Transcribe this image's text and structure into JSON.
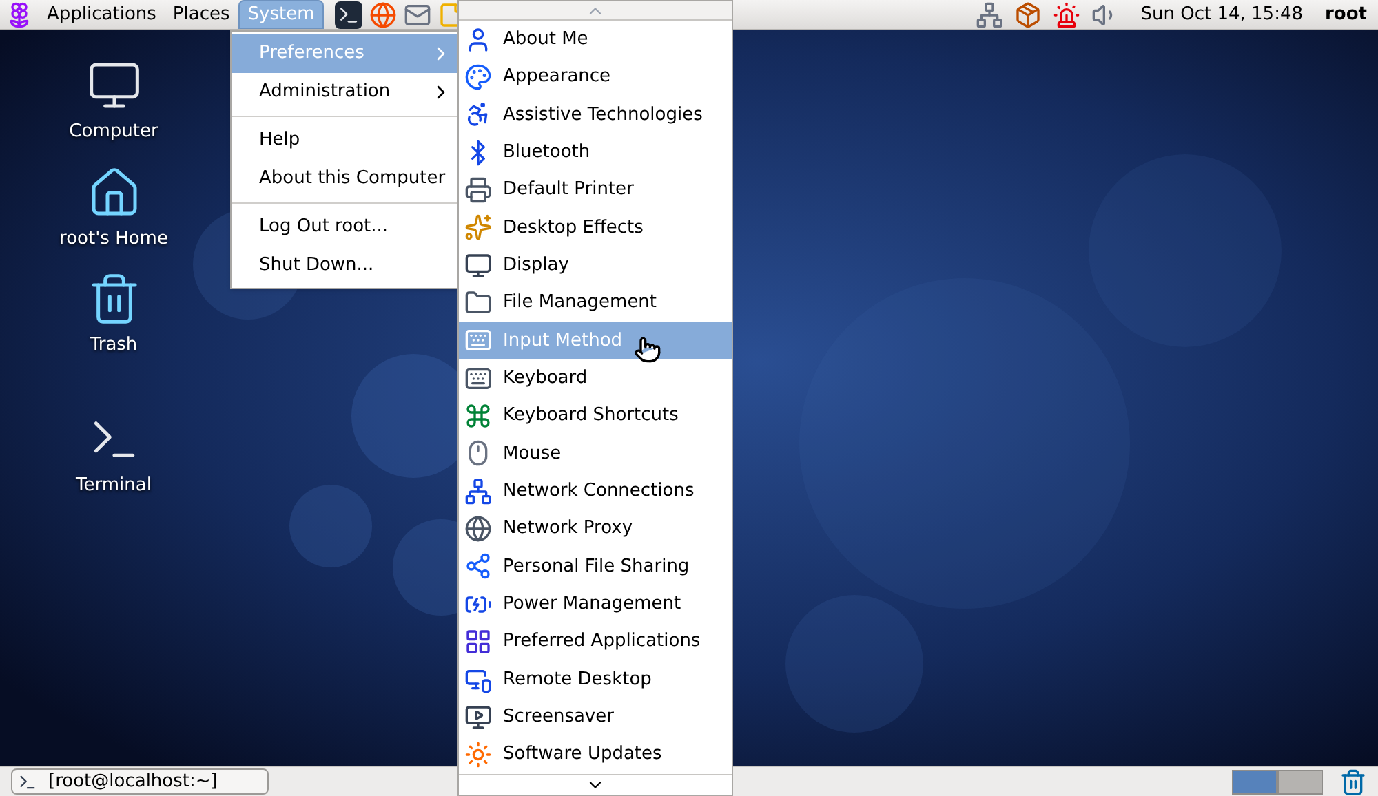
{
  "top_panel": {
    "menus": [
      {
        "label": "Applications",
        "selected": false
      },
      {
        "label": "Places",
        "selected": false
      },
      {
        "label": "System",
        "selected": true
      }
    ],
    "clock": "Sun Oct 14, 15:48",
    "user": "root"
  },
  "desktop_icons": [
    {
      "label": "Computer",
      "kind": "computer"
    },
    {
      "label": "root's Home",
      "kind": "home"
    },
    {
      "label": "Trash",
      "kind": "trash"
    },
    {
      "label": "Terminal",
      "kind": "terminal"
    }
  ],
  "system_menu": [
    {
      "kind": "item",
      "label": "Preferences",
      "submenu": true,
      "selected": true
    },
    {
      "kind": "item",
      "label": "Administration",
      "submenu": true,
      "selected": false
    },
    {
      "kind": "separator"
    },
    {
      "kind": "item",
      "label": "Help",
      "submenu": false,
      "selected": false
    },
    {
      "kind": "item",
      "label": "About this Computer",
      "submenu": false,
      "selected": false
    },
    {
      "kind": "separator"
    },
    {
      "kind": "item",
      "label": "Log Out root...",
      "submenu": false,
      "selected": false
    },
    {
      "kind": "item",
      "label": "Shut Down...",
      "submenu": false,
      "selected": false
    }
  ],
  "preferences_menu": [
    {
      "label": "About Me",
      "selected": false
    },
    {
      "label": "Appearance",
      "selected": false
    },
    {
      "label": "Assistive Technologies",
      "selected": false
    },
    {
      "label": "Bluetooth",
      "selected": false
    },
    {
      "label": "Default Printer",
      "selected": false
    },
    {
      "label": "Desktop Effects",
      "selected": false
    },
    {
      "label": "Display",
      "selected": false
    },
    {
      "label": "File Management",
      "selected": false
    },
    {
      "label": "Input Method",
      "selected": true
    },
    {
      "label": "Keyboard",
      "selected": false
    },
    {
      "label": "Keyboard Shortcuts",
      "selected": false
    },
    {
      "label": "Mouse",
      "selected": false
    },
    {
      "label": "Network Connections",
      "selected": false
    },
    {
      "label": "Network Proxy",
      "selected": false
    },
    {
      "label": "Personal File Sharing",
      "selected": false
    },
    {
      "label": "Power Management",
      "selected": false
    },
    {
      "label": "Preferred Applications",
      "selected": false
    },
    {
      "label": "Remote Desktop",
      "selected": false
    },
    {
      "label": "Screensaver",
      "selected": false
    },
    {
      "label": "Software Updates",
      "selected": false
    }
  ],
  "bottom_panel": {
    "window_button": "[root@localhost:~]",
    "workspaces": [
      {
        "selected": true
      },
      {
        "selected": false
      }
    ]
  }
}
